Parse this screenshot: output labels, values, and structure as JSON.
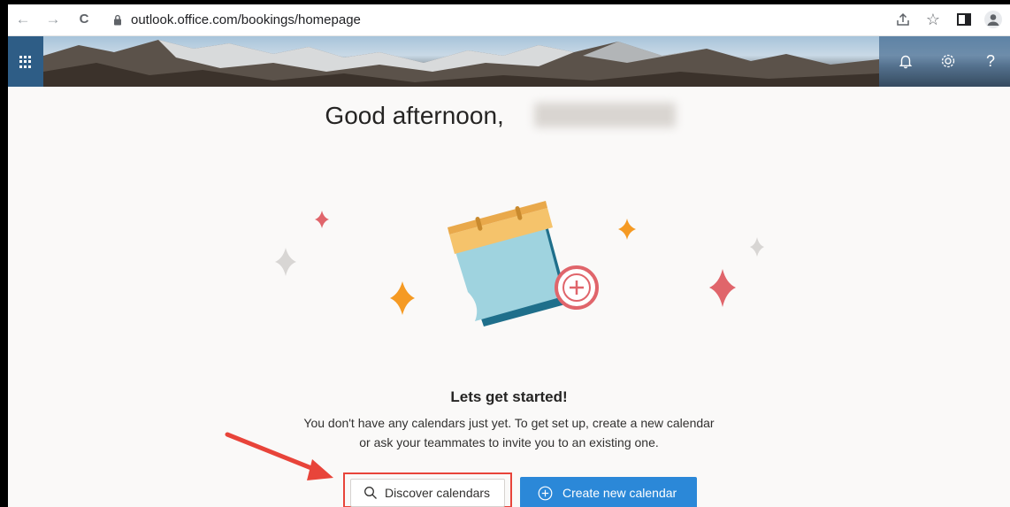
{
  "browser": {
    "url": "outlook.office.com/bookings/homepage",
    "back_glyph": "←",
    "forward_glyph": "→",
    "reload_glyph": "C",
    "star_glyph": "☆"
  },
  "header": {
    "help_glyph": "?"
  },
  "main": {
    "greeting": "Good afternoon,",
    "title": "Lets get started!",
    "description_line1": "You don't have any calendars just yet. To get set up, create a new calendar",
    "description_line2": "or ask your teammates to invite you to an existing one.",
    "discover_label": "Discover calendars",
    "create_label": "Create new calendar"
  },
  "colors": {
    "primary_button": "#2b88d8",
    "annotation_red": "#e8443a",
    "waffle_bg": "#2e5d86"
  },
  "icons": [
    "lock-icon",
    "share-icon",
    "star-icon",
    "sidepanel-icon",
    "profile-icon",
    "app-launcher-icon",
    "bell-icon",
    "gear-icon",
    "help-icon",
    "search-icon",
    "add-circle-icon",
    "calendar-illustration"
  ]
}
